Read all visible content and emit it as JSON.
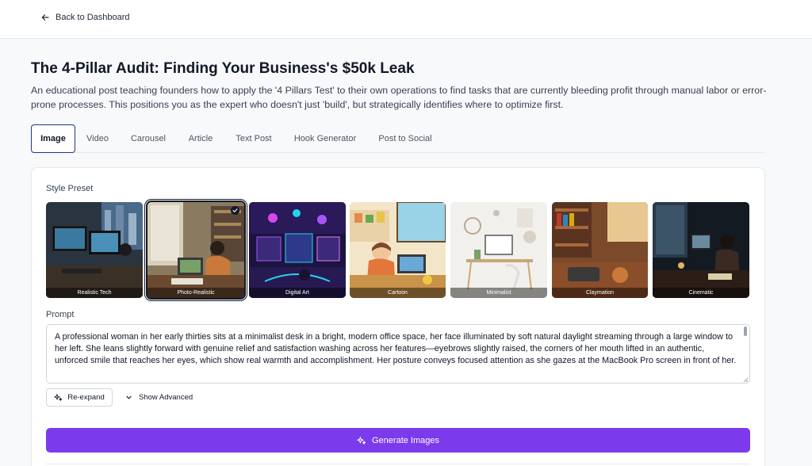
{
  "nav": {
    "back_label": "Back to Dashboard"
  },
  "header": {
    "title": "The 4-Pillar Audit: Finding Your Business's $50k Leak",
    "description": "An educational post teaching founders how to apply the '4 Pillars Test' to their own operations to find tasks that are currently bleeding profit through manual labor or error-prone processes. This positions you as the expert who doesn't just 'build', but strategically identifies where to optimize first."
  },
  "tabs": [
    {
      "label": "Image",
      "active": true
    },
    {
      "label": "Video"
    },
    {
      "label": "Carousel"
    },
    {
      "label": "Article"
    },
    {
      "label": "Text Post"
    },
    {
      "label": "Hook Generator"
    },
    {
      "label": "Post to Social"
    }
  ],
  "style_preset": {
    "label": "Style Preset",
    "selected": "Photo-Realistic",
    "items": [
      {
        "label": "Realistic Tech"
      },
      {
        "label": "Photo-Realistic"
      },
      {
        "label": "Digital Art"
      },
      {
        "label": "Cartoon"
      },
      {
        "label": "Minimalist"
      },
      {
        "label": "Claymation"
      },
      {
        "label": "Cinematic"
      }
    ]
  },
  "prompt": {
    "label": "Prompt",
    "value": "A professional woman in her early thirties sits at a minimalist desk in a bright, modern office space, her face illuminated by soft natural daylight streaming through a large window to her left. She leans slightly forward with genuine relief and satisfaction washing across her features—eyebrows slightly raised, the corners of her mouth lifted in an authentic, unforced smile that reaches her eyes, which show real warmth and accomplishment. Her posture conveys focused attention as she gazes at the MacBook Pro screen in front of her."
  },
  "actions": {
    "reexpand_label": "Re-expand",
    "advanced_label": "Show Advanced",
    "generate_label": "Generate Images"
  },
  "colors": {
    "accent": "#7c3aed",
    "active_tab_border": "#1e3a8a"
  }
}
